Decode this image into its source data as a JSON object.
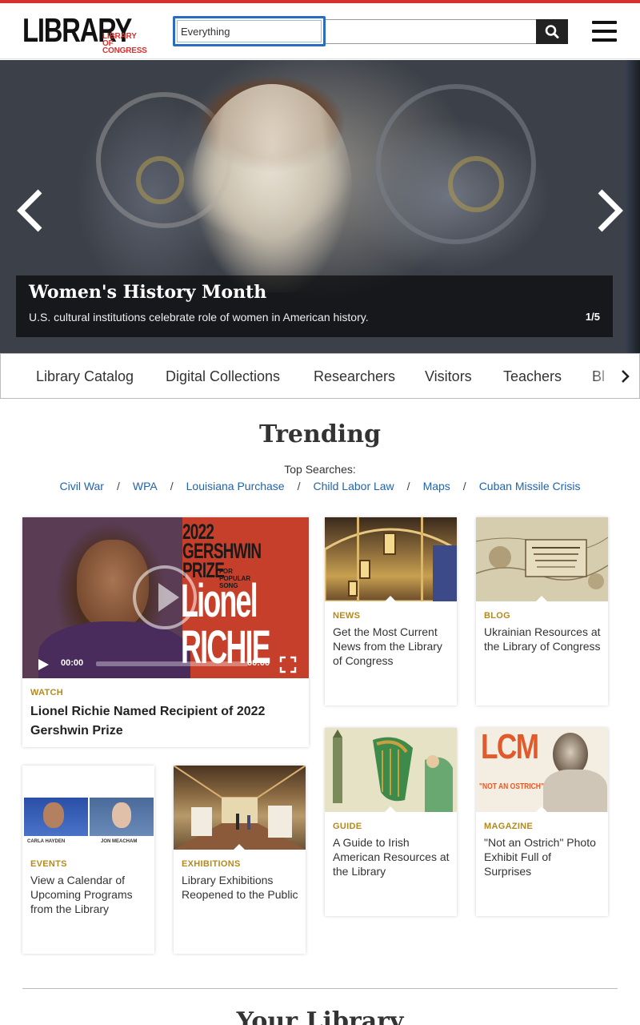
{
  "header": {
    "logo_main": "LIBRARY",
    "logo_sub_1": "LIBRARY",
    "logo_sub_2": "OF CONGRESS",
    "search_scope": "Everything",
    "search_placeholder": "",
    "accent_color": "#d7322f"
  },
  "hero": {
    "title": "Women's History Month",
    "description": "U.S. cultural institutions celebrate role of women in American history.",
    "slide_counter": "1/5",
    "current_slide": 1,
    "total_slides": 5
  },
  "nav": {
    "tabs": [
      "Library Catalog",
      "Digital Collections",
      "Researchers",
      "Visitors",
      "Teachers",
      "Bl"
    ]
  },
  "trending": {
    "title": "Trending",
    "top_searches_label": "Top Searches:",
    "links": [
      "Civil War",
      "WPA",
      "Louisiana Purchase",
      "Child Labor Law",
      "Maps",
      "Cuban Missile Crisis"
    ],
    "separator": "/"
  },
  "video": {
    "category": "WATCH",
    "title": "Lionel Richie Named Recipient of 2022 Gershwin Prize",
    "time_current": "00:00",
    "time_total": "00:00",
    "overlay_year": "2022",
    "overlay_line1": "GERSHWIN",
    "overlay_line2": "PRIZE",
    "overlay_small_1": "FOR",
    "overlay_small_2": "POPULAR",
    "overlay_small_3": "SONG",
    "overlay_name_1": "Lionel",
    "overlay_name_2": "RICHIE"
  },
  "cards": [
    {
      "category": "NEWS",
      "title": "Get the Most Current News from the Library of Congress"
    },
    {
      "category": "BLOG",
      "title": "Ukrainian Resources at the Library of Congress"
    },
    {
      "category": "GUIDE",
      "title": "A Guide to Irish American Resources at the Library"
    },
    {
      "category": "MAGAZINE",
      "title": "\"Not an Ostrich\" Photo Exhibit Full of Surprises"
    },
    {
      "category": "EVENTS",
      "title": "View a Calendar of Upcoming Programs from the Library"
    },
    {
      "category": "EXHIBITIONS",
      "title": "Library Exhibitions Reopened to the Public"
    }
  ],
  "thumbs": {
    "events_name_1": "CARLA HAYDEN",
    "events_name_2": "JON MEACHAM",
    "magazine_lcm": "LCM",
    "magazine_tag": "\"NOT AN OSTRICH\""
  },
  "your_library": "Your Library"
}
